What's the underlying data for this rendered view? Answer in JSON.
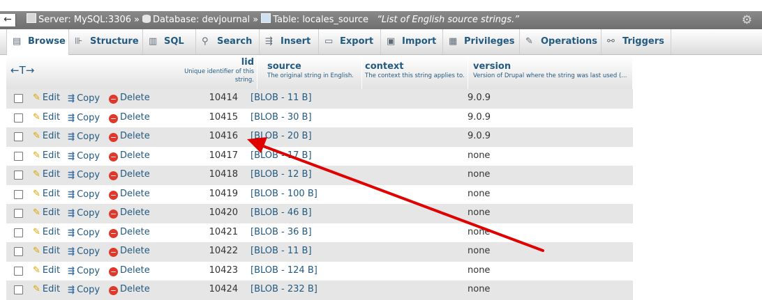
{
  "breadcrumb": {
    "back_glyph": "←",
    "server": "Server: MySQL:3306",
    "separator": "»",
    "database": "Database: devjournal",
    "table": "Table: locales_source",
    "comment": "“List of English source strings.”",
    "gear_glyph": "⚙"
  },
  "tabs": [
    {
      "label": "Browse",
      "icon": "browse-icon"
    },
    {
      "label": "Structure",
      "icon": "structure-icon"
    },
    {
      "label": "SQL",
      "icon": "sql-icon"
    },
    {
      "label": "Search",
      "icon": "search-icon"
    },
    {
      "label": "Insert",
      "icon": "insert-icon"
    },
    {
      "label": "Export",
      "icon": "export-icon"
    },
    {
      "label": "Import",
      "icon": "import-icon"
    },
    {
      "label": "Privileges",
      "icon": "privileges-icon"
    },
    {
      "label": "Operations",
      "icon": "operations-icon"
    },
    {
      "label": "Triggers",
      "icon": "triggers-icon"
    }
  ],
  "table": {
    "arrows_glyph": "←T→",
    "columns": [
      {
        "name": "lid",
        "desc": "Unique identifier of this string."
      },
      {
        "name": "source",
        "desc": "The original string in English."
      },
      {
        "name": "context",
        "desc": "The context this string applies to."
      },
      {
        "name": "version",
        "desc": "Version of Drupal where the string was last used (..."
      }
    ],
    "actions": {
      "edit": "Edit",
      "copy": "Copy",
      "delete": "Delete"
    },
    "rows": [
      {
        "lid": "10414",
        "source": "[BLOB - 11 B]",
        "version": "9.0.9"
      },
      {
        "lid": "10415",
        "source": "[BLOB - 30 B]",
        "version": "9.0.9"
      },
      {
        "lid": "10416",
        "source": "[BLOB - 20 B]",
        "version": "9.0.9"
      },
      {
        "lid": "10417",
        "source": "[BLOB - 17 B]",
        "version": "none"
      },
      {
        "lid": "10418",
        "source": "[BLOB - 12 B]",
        "version": "none"
      },
      {
        "lid": "10419",
        "source": "[BLOB - 100 B]",
        "version": "none"
      },
      {
        "lid": "10420",
        "source": "[BLOB - 46 B]",
        "version": "none"
      },
      {
        "lid": "10421",
        "source": "[BLOB - 36 B]",
        "version": "none"
      },
      {
        "lid": "10422",
        "source": "[BLOB - 11 B]",
        "version": "none"
      },
      {
        "lid": "10423",
        "source": "[BLOB - 124 B]",
        "version": "none"
      },
      {
        "lid": "10424",
        "source": "[BLOB - 232 B]",
        "version": "none"
      }
    ]
  },
  "annotation_color": "#e00000"
}
